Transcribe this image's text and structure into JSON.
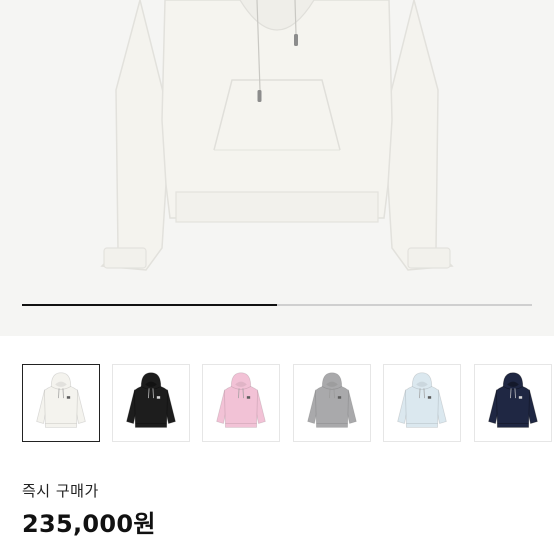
{
  "hero": {
    "image": "white-hoodie-photo",
    "progress_fraction": 0.5
  },
  "colors": {
    "white": "#f4f3ee",
    "black": "#1d1d1d",
    "pink": "#f2c2d6",
    "gray": "#a9a9ab",
    "sky": "#dbe8ef",
    "navy": "#1f2743"
  },
  "thumbnails": [
    {
      "color_key": "white",
      "selected": true
    },
    {
      "color_key": "black",
      "selected": false
    },
    {
      "color_key": "pink",
      "selected": false
    },
    {
      "color_key": "gray",
      "selected": false
    },
    {
      "color_key": "sky",
      "selected": false
    },
    {
      "color_key": "navy",
      "selected": false
    }
  ],
  "purchase": {
    "label": "즉시 구매가",
    "price": "235,000원"
  }
}
